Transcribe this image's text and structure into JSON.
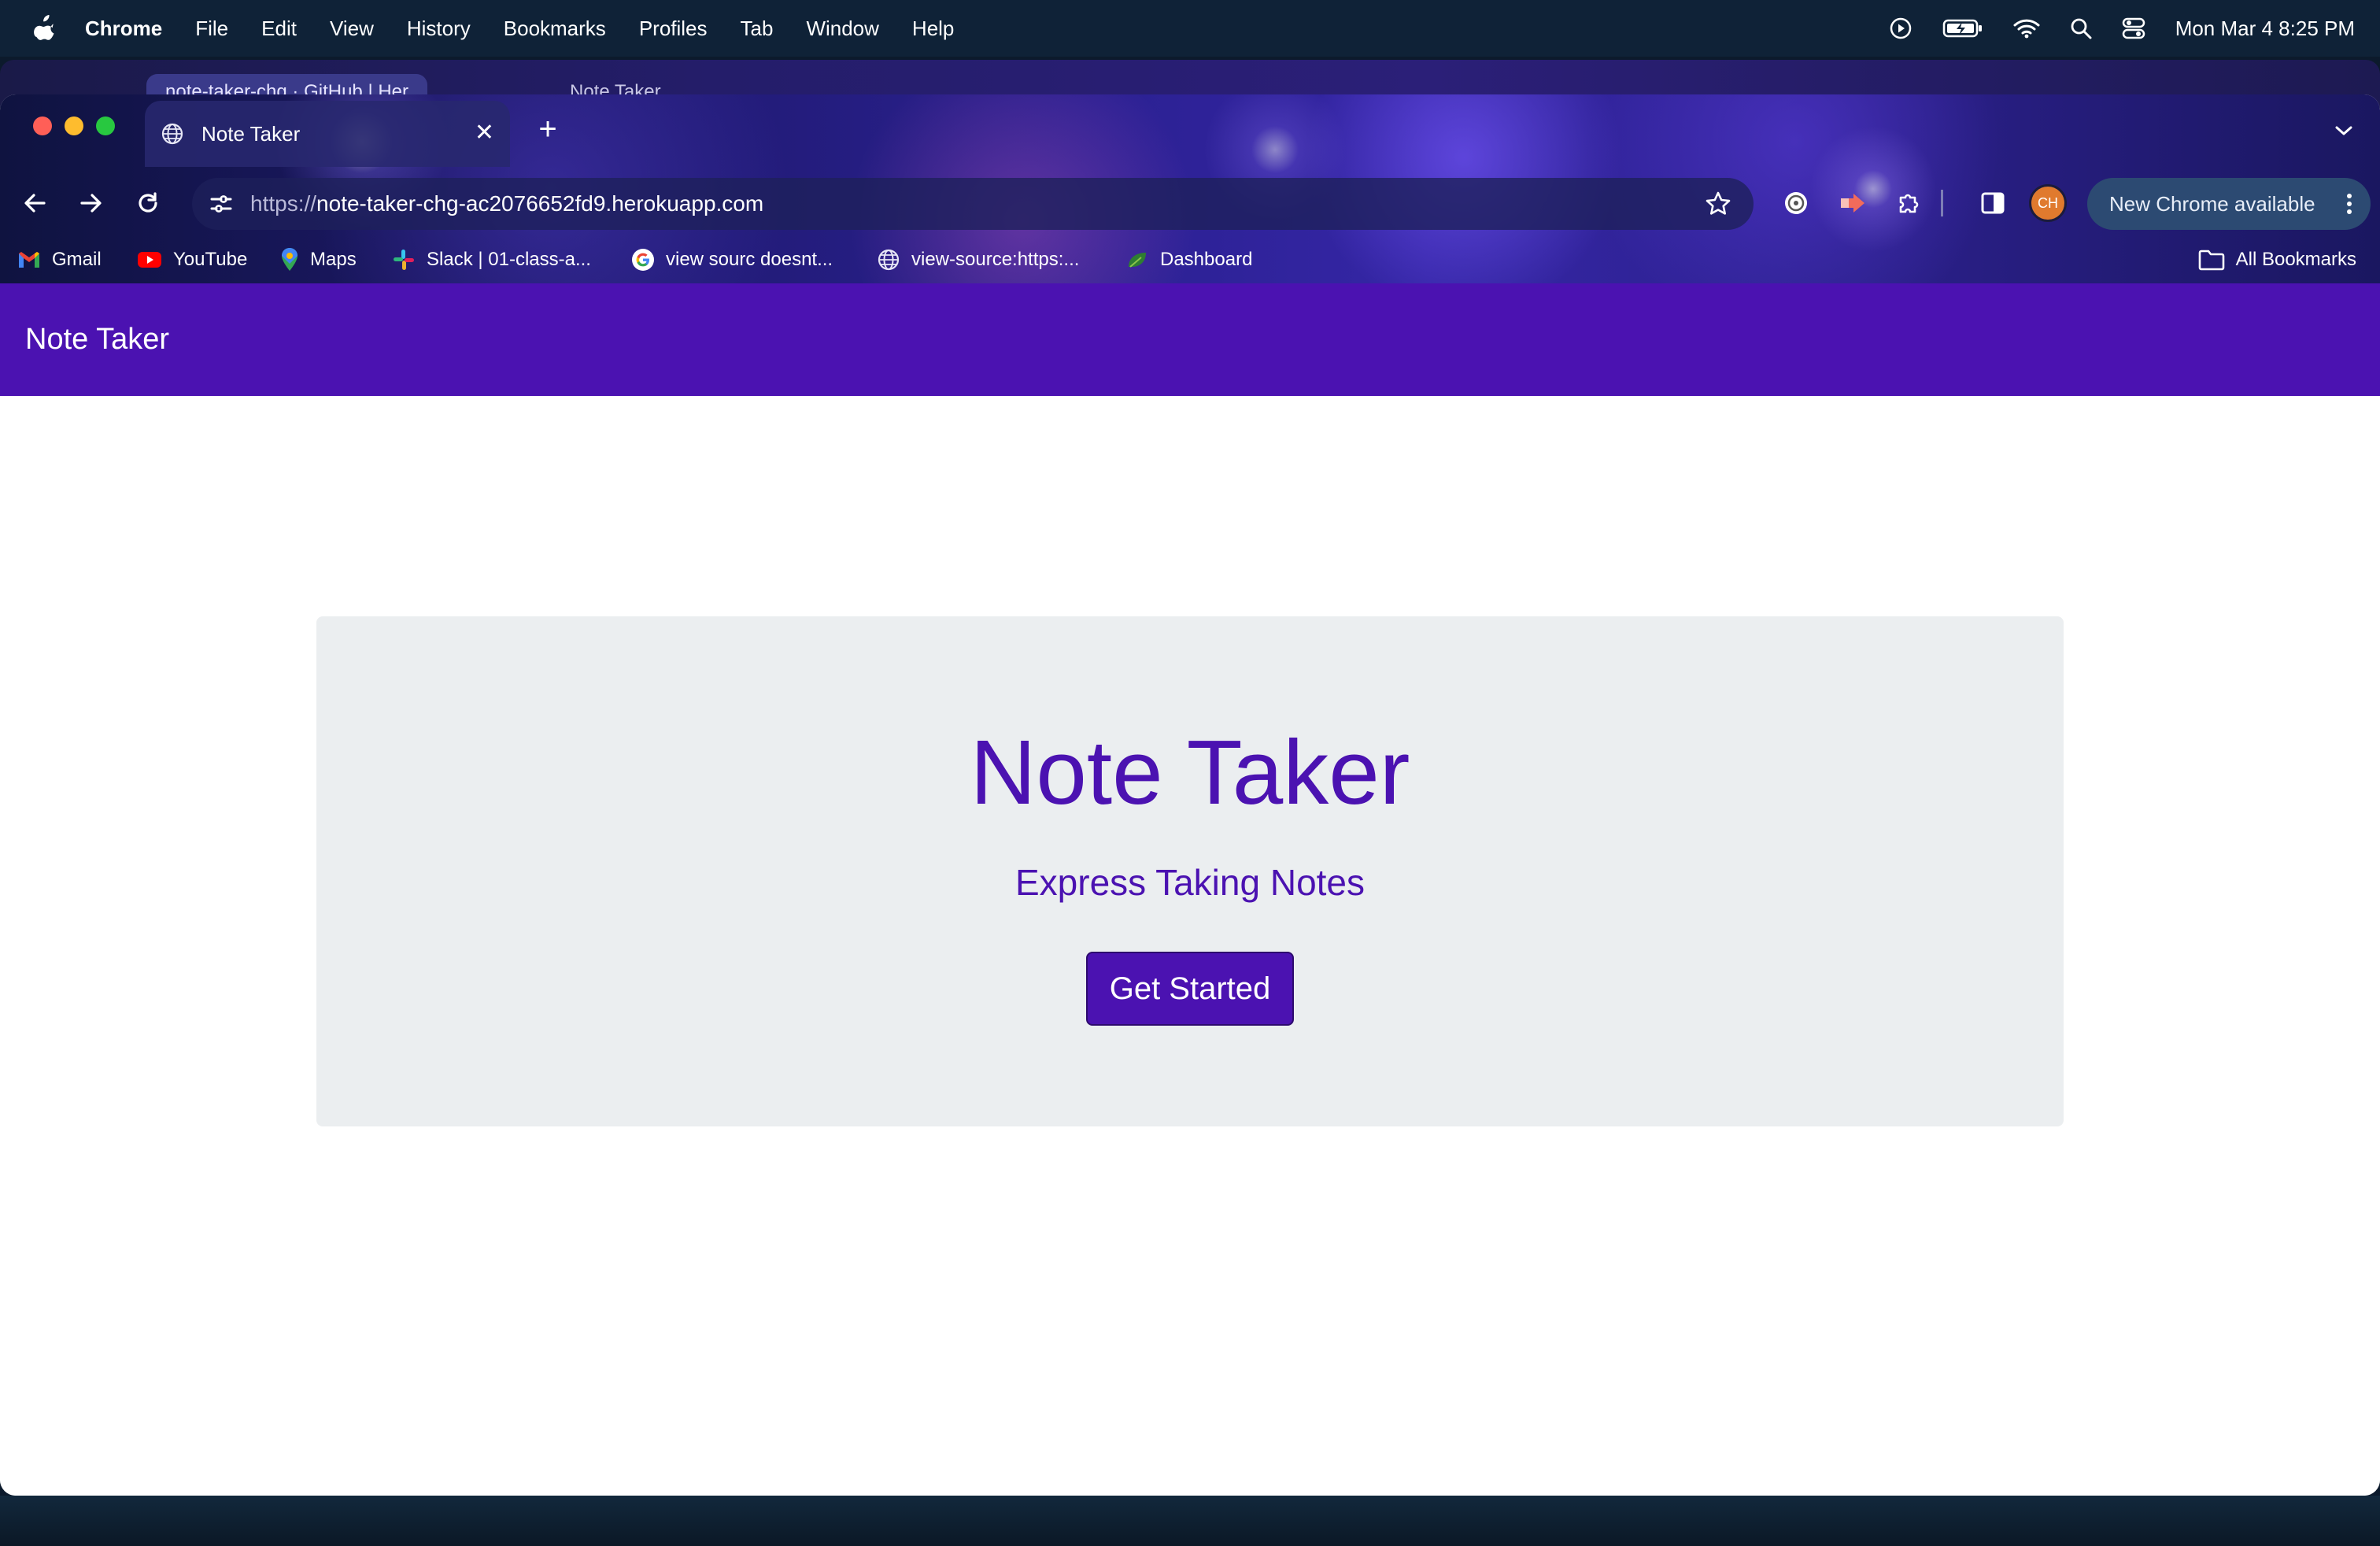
{
  "menubar": {
    "app": "Chrome",
    "items": [
      "File",
      "Edit",
      "View",
      "History",
      "Bookmarks",
      "Profiles",
      "Tab",
      "Window",
      "Help"
    ],
    "clock": "Mon Mar 4  8:25 PM"
  },
  "background_window": {
    "tabs": [
      {
        "title": "note-taker-chg · GitHub | Her"
      },
      {
        "title": "Note Taker"
      }
    ]
  },
  "browser": {
    "tab": {
      "title": "Note Taker"
    },
    "url": {
      "scheme": "https://",
      "host": "note-taker-chg-ac2076652fd9.herokuapp.com"
    },
    "profile_initials": "CH",
    "update_label": "New Chrome available",
    "bookmarks": [
      {
        "label": "Gmail",
        "icon": "gmail-icon"
      },
      {
        "label": "YouTube",
        "icon": "youtube-icon"
      },
      {
        "label": "Maps",
        "icon": "maps-icon"
      },
      {
        "label": "Slack | 01-class-a...",
        "icon": "slack-icon"
      },
      {
        "label": "view sourc doesnt...",
        "icon": "google-icon"
      },
      {
        "label": "view-source:https:...",
        "icon": "globe-icon"
      },
      {
        "label": "Dashboard",
        "icon": "leaf-icon"
      }
    ],
    "all_bookmarks": "All Bookmarks"
  },
  "page": {
    "nav_brand": "Note Taker",
    "hero": {
      "title": "Note Taker",
      "subtitle": "Express Taking Notes",
      "button": "Get Started"
    }
  },
  "colors": {
    "brand": "#4b12b1",
    "jumbotron_bg": "#ebeef0"
  }
}
